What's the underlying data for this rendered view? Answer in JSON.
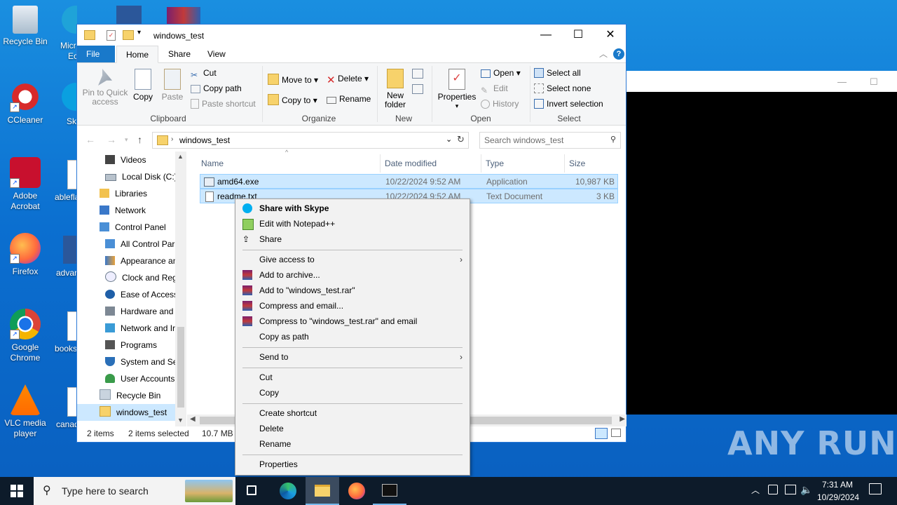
{
  "desktop": {
    "icons": [
      {
        "label": "Recycle Bin"
      },
      {
        "label": "CCleaner"
      },
      {
        "label": "Adobe Acrobat"
      },
      {
        "label": "Firefox"
      },
      {
        "label": "Google Chrome"
      },
      {
        "label": "VLC media player"
      }
    ],
    "peek_labels": [
      "Micr",
      "Ec",
      "Sk",
      "ablefla",
      "advar",
      "books",
      "canad"
    ]
  },
  "explorer": {
    "title": "windows_test",
    "tabs": [
      "File",
      "Home",
      "Share",
      "View"
    ],
    "ribbon": {
      "clipboard": {
        "pin": "Pin to Quick access",
        "copy": "Copy",
        "paste": "Paste",
        "cut": "Cut",
        "copy_path": "Copy path",
        "paste_shortcut": "Paste shortcut",
        "label": "Clipboard"
      },
      "organize": {
        "move_to": "Move to",
        "copy_to": "Copy to",
        "delete": "Delete",
        "rename": "Rename",
        "label": "Organize"
      },
      "new": {
        "new_folder": "New folder",
        "label": "New"
      },
      "open": {
        "properties": "Properties",
        "open": "Open",
        "edit": "Edit",
        "history": "History",
        "label": "Open"
      },
      "select": {
        "select_all": "Select all",
        "select_none": "Select none",
        "invert": "Invert selection",
        "label": "Select"
      }
    },
    "address": {
      "path": "windows_test",
      "search_placeholder": "Search windows_test"
    },
    "nav": [
      "Videos",
      "Local Disk (C:)",
      "Libraries",
      "Network",
      "Control Panel",
      "All Control Par",
      "Appearance an",
      "Clock and Regi",
      "Ease of Access",
      "Hardware and",
      "Network and Ir",
      "Programs",
      "System and Sec",
      "User Accounts",
      "Recycle Bin",
      "windows_test"
    ],
    "columns": [
      "Name",
      "Date modified",
      "Type",
      "Size"
    ],
    "files": [
      {
        "name": "amd64.exe",
        "date": "10/22/2024 9:52 AM",
        "type": "Application",
        "size": "10,987 KB"
      },
      {
        "name": "readme.txt",
        "date": "10/22/2024 9:52 AM",
        "type": "Text Document",
        "size": "3 KB"
      }
    ],
    "status": {
      "count": "2 items",
      "selected": "2 items selected",
      "size": "10.7 MB"
    }
  },
  "context_menu": {
    "items": [
      "Share with Skype",
      "Edit with Notepad++",
      "Share",
      "Give access to",
      "Add to archive...",
      "Add to \"windows_test.rar\"",
      "Compress and email...",
      "Compress to \"windows_test.rar\" and email",
      "Copy as path",
      "Send to",
      "Cut",
      "Copy",
      "Create shortcut",
      "Delete",
      "Rename",
      "Properties"
    ]
  },
  "taskbar": {
    "search_placeholder": "Type here to search",
    "time": "7:31 AM",
    "date": "10/29/2024"
  },
  "watermark": "ANY RUN"
}
